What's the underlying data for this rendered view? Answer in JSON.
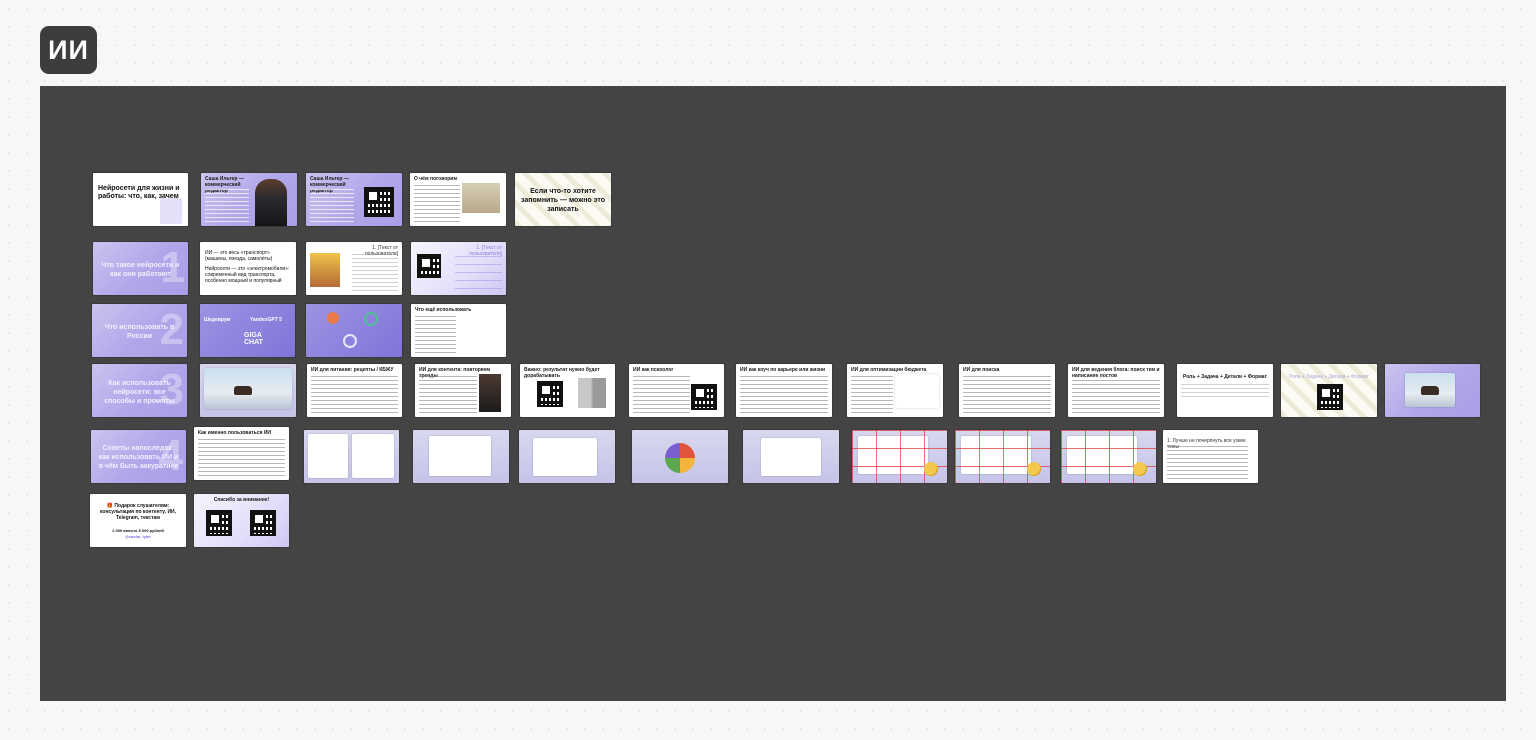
{
  "board": {
    "title": "ИИ"
  },
  "slides": {
    "s1": "Нейросети для жизни и работы: что, как, зачем",
    "s2": "Саша Ильтер — коммерческий редактор",
    "s3": "Саша Ильтер — коммерческий редактор",
    "s4": "О чём поговорим",
    "s5": "Если что-то хотите запомнить — можно это записать",
    "s6": "Что такое нейросети и как они работают",
    "s7a": "ИИ — это весь «транспорт» (машины, поезда, самолёты)",
    "s7b": "Нейросети — это «электромобили»: современный вид транспорта, особенно мощный и популярный",
    "s8": "1. [Текст от пользователя]",
    "s9": "1. [Текст от пользователя]",
    "s10": "Что использовать в России",
    "s11a": "Шедеврум",
    "s11b": "YandexGPT 5",
    "s11c": "GIGA CHAT",
    "s13": "Что ещё использовать",
    "s14": "Как использовать нейросети: все способы и промпты",
    "s16": "ИИ для питания: рецепты / КБЖУ",
    "s17": "ИИ для контента: повторяем тренды",
    "s18": "Важно: результат нужно будет дорабатывать",
    "s19": "ИИ как психолог",
    "s20": "ИИ как коуч по карьере или жизни",
    "s21": "ИИ для оптимизации бюджета",
    "s22": "ИИ для поиска",
    "s23": "ИИ для ведения блога: поиск тем и написание постов",
    "s24": "Роль + Задача + Детали + Формат",
    "s25": "Роль + Задача + Детали + Формат",
    "s27": "Советы напоследок: как использовать ИИ и в чём быть аккуратнее",
    "s28": "Как именно пользоваться ИИ",
    "s37": "1. Лучше не почерпнуть все узкие темы",
    "s38": "🎁 Подарок слушателям: консультация по контенту, ИИ, Telegram, текстам",
    "s38b": "2 000 вместо 5 000 рублей",
    "s38c": "@sasha_iyter",
    "s39": "Спасибо за внимание!"
  },
  "colors": {
    "frame": "#444444",
    "badge": "#3d3d3d",
    "accent_purple": "#a99fe6",
    "slide_white": "#ffffff"
  }
}
